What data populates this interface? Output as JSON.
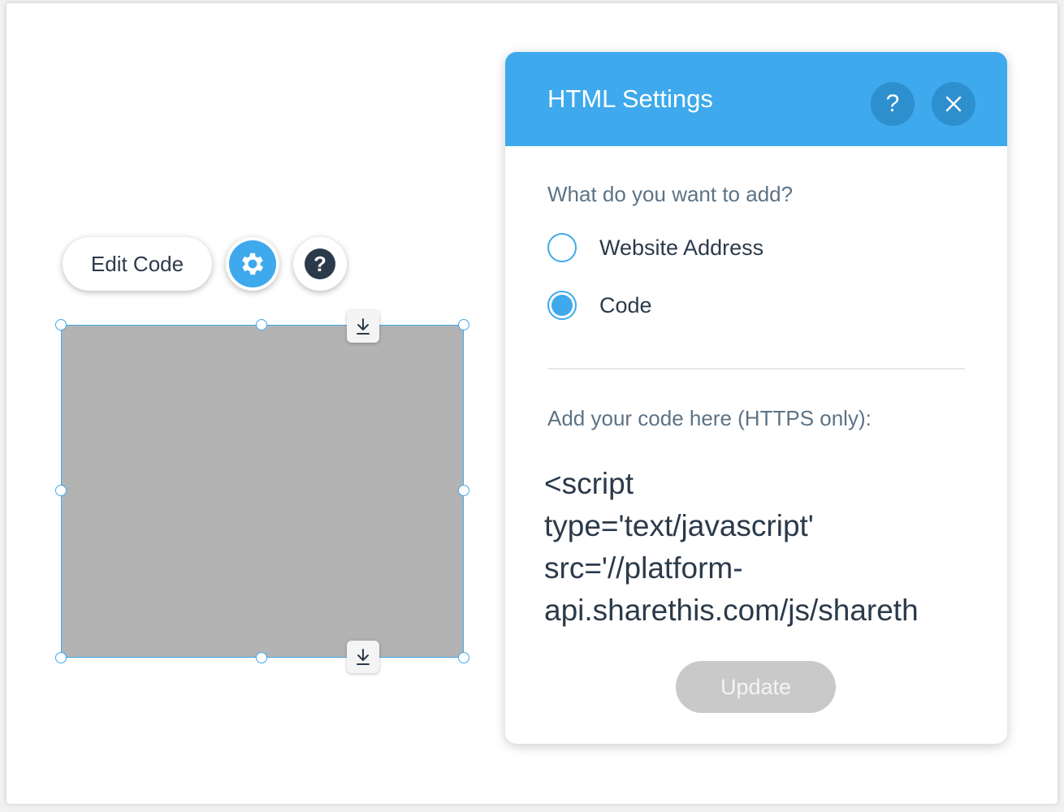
{
  "toolbar": {
    "edit_code_label": "Edit Code",
    "settings_icon": "gear-icon",
    "help_icon": "question-icon",
    "help_glyph": "?"
  },
  "element": {
    "fill_color": "#b3b3b3",
    "selection_color": "#3ea9ec",
    "anchor_icon": "download-icon"
  },
  "panel": {
    "title": "HTML Settings",
    "header_color": "#3ea9ec",
    "help_glyph": "?",
    "close_icon": "close-icon",
    "question": "What do you want to add?",
    "options": [
      {
        "label": "Website Address",
        "checked": false
      },
      {
        "label": "Code",
        "checked": true
      }
    ],
    "code_label": "Add your code here (HTTPS only):",
    "code_value": "<script\ntype='text/javascript'\nsrc='//platform-\napi.sharethis.com/js/shareth",
    "update_label": "Update",
    "update_enabled": false
  }
}
